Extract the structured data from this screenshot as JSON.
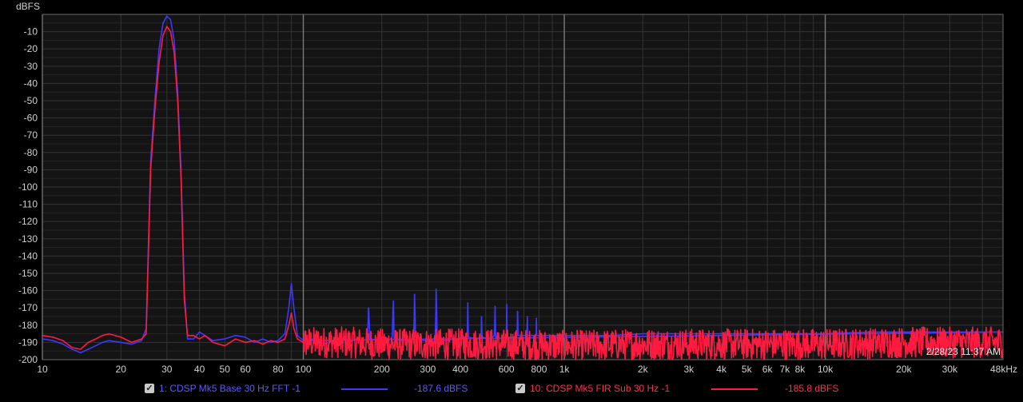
{
  "chart_data": {
    "type": "line",
    "title": "",
    "ylabel": "dBFS",
    "xlabel": "",
    "x_scale": "log",
    "xlim": [
      10,
      48000
    ],
    "ylim": [
      -200,
      0
    ],
    "grid": true,
    "y_ticks": [
      -10,
      -20,
      -30,
      -40,
      -50,
      -60,
      -70,
      -80,
      -90,
      -100,
      -110,
      -120,
      -130,
      -140,
      -150,
      -160,
      -170,
      -180,
      -190,
      -200
    ],
    "x_ticks": [
      {
        "v": 10,
        "label": "10"
      },
      {
        "v": 20,
        "label": "20"
      },
      {
        "v": 30,
        "label": "30"
      },
      {
        "v": 40,
        "label": "40"
      },
      {
        "v": 50,
        "label": "50"
      },
      {
        "v": 60,
        "label": "60"
      },
      {
        "v": 80,
        "label": "80"
      },
      {
        "v": 100,
        "label": "100"
      },
      {
        "v": 200,
        "label": "200"
      },
      {
        "v": 300,
        "label": "300"
      },
      {
        "v": 400,
        "label": "400"
      },
      {
        "v": 600,
        "label": "600"
      },
      {
        "v": 800,
        "label": "800"
      },
      {
        "v": 1000,
        "label": "1k"
      },
      {
        "v": 2000,
        "label": "2k"
      },
      {
        "v": 3000,
        "label": "3k"
      },
      {
        "v": 4000,
        "label": "4k"
      },
      {
        "v": 5000,
        "label": "5k"
      },
      {
        "v": 6000,
        "label": "6k"
      },
      {
        "v": 7000,
        "label": "7k"
      },
      {
        "v": 8000,
        "label": "8k"
      },
      {
        "v": 10000,
        "label": "10k"
      },
      {
        "v": 20000,
        "label": "20k"
      },
      {
        "v": 30000,
        "label": "30k"
      },
      {
        "v": 48000,
        "label": "48kHz"
      }
    ],
    "series": [
      {
        "name": "1: CDSP Mk5 Base 30 Hz FFT -1",
        "color": "#3a3aff",
        "summary_value": "-187.6 dBFS",
        "points": [
          [
            10,
            -188
          ],
          [
            11,
            -189
          ],
          [
            12,
            -191
          ],
          [
            13,
            -194
          ],
          [
            14,
            -196
          ],
          [
            15,
            -194
          ],
          [
            16,
            -192
          ],
          [
            17,
            -190
          ],
          [
            18,
            -189
          ],
          [
            20,
            -190
          ],
          [
            22,
            -191
          ],
          [
            23,
            -190
          ],
          [
            24,
            -189
          ],
          [
            25,
            -182
          ],
          [
            26,
            -85
          ],
          [
            27,
            -50
          ],
          [
            28,
            -20
          ],
          [
            29,
            -5
          ],
          [
            30,
            -1
          ],
          [
            31,
            -3
          ],
          [
            32,
            -15
          ],
          [
            33,
            -45
          ],
          [
            34,
            -90
          ],
          [
            35,
            -160
          ],
          [
            36,
            -188
          ],
          [
            38,
            -188
          ],
          [
            40,
            -184
          ],
          [
            42,
            -186
          ],
          [
            45,
            -189
          ],
          [
            50,
            -188
          ],
          [
            55,
            -186
          ],
          [
            60,
            -187
          ],
          [
            65,
            -190
          ],
          [
            70,
            -188
          ],
          [
            75,
            -190
          ],
          [
            80,
            -189
          ],
          [
            85,
            -185
          ],
          [
            88,
            -170
          ],
          [
            90,
            -156
          ],
          [
            92,
            -170
          ],
          [
            95,
            -186
          ],
          [
            100,
            -189
          ],
          [
            110,
            -188
          ],
          [
            120,
            -191
          ],
          [
            130,
            -189
          ],
          [
            140,
            -188
          ],
          [
            150,
            -190
          ],
          [
            160,
            -188
          ],
          [
            170,
            -189
          ],
          [
            176,
            -188
          ],
          [
            178,
            -171
          ],
          [
            180,
            -188
          ],
          [
            200,
            -189
          ],
          [
            210,
            -190
          ],
          [
            219,
            -187
          ],
          [
            221,
            -170
          ],
          [
            223,
            -188
          ],
          [
            240,
            -189
          ],
          [
            260,
            -188
          ],
          [
            265,
            -187
          ],
          [
            267,
            -164
          ],
          [
            269,
            -187
          ],
          [
            290,
            -189
          ],
          [
            310,
            -189
          ],
          [
            320,
            -187
          ],
          [
            323,
            -165
          ],
          [
            326,
            -187
          ],
          [
            350,
            -189
          ],
          [
            380,
            -188
          ],
          [
            400,
            -188
          ],
          [
            425,
            -186
          ],
          [
            427,
            -172
          ],
          [
            429,
            -187
          ],
          [
            460,
            -188
          ],
          [
            480,
            -187
          ],
          [
            482,
            -175
          ],
          [
            484,
            -187
          ],
          [
            520,
            -188
          ],
          [
            540,
            -186
          ],
          [
            543,
            -172
          ],
          [
            546,
            -187
          ],
          [
            580,
            -188
          ],
          [
            600,
            -186
          ],
          [
            602,
            -168
          ],
          [
            604,
            -187
          ],
          [
            640,
            -187
          ],
          [
            660,
            -186
          ],
          [
            662,
            -172
          ],
          [
            664,
            -186
          ],
          [
            720,
            -186
          ],
          [
            722,
            -175
          ],
          [
            724,
            -186
          ],
          [
            780,
            -186
          ],
          [
            782,
            -176
          ],
          [
            784,
            -186
          ],
          [
            850,
            -186
          ],
          [
            1000,
            -186
          ],
          [
            1200,
            -186
          ],
          [
            1500,
            -186
          ],
          [
            2000,
            -185
          ],
          [
            3000,
            -185
          ],
          [
            4000,
            -185
          ],
          [
            5000,
            -185
          ],
          [
            7000,
            -185
          ],
          [
            10000,
            -185
          ],
          [
            15000,
            -184
          ],
          [
            20000,
            -184
          ],
          [
            30000,
            -184
          ],
          [
            48000,
            -184
          ]
        ]
      },
      {
        "name": "10: CDSP Mk5 FIR Sub 30 Hz -1",
        "color": "#ff1a40",
        "summary_value": "-185.8 dBFS",
        "points": [
          [
            10,
            -186
          ],
          [
            11,
            -187
          ],
          [
            12,
            -189
          ],
          [
            13,
            -193
          ],
          [
            14,
            -194
          ],
          [
            15,
            -190
          ],
          [
            16,
            -188
          ],
          [
            17,
            -186
          ],
          [
            18,
            -185
          ],
          [
            20,
            -187
          ],
          [
            22,
            -190
          ],
          [
            23,
            -189
          ],
          [
            24,
            -188
          ],
          [
            25,
            -185
          ],
          [
            26,
            -90
          ],
          [
            27,
            -55
          ],
          [
            28,
            -28
          ],
          [
            29,
            -12
          ],
          [
            30,
            -7
          ],
          [
            31,
            -10
          ],
          [
            32,
            -22
          ],
          [
            33,
            -50
          ],
          [
            34,
            -95
          ],
          [
            35,
            -165
          ],
          [
            36,
            -186
          ],
          [
            38,
            -186
          ],
          [
            40,
            -188
          ],
          [
            42,
            -186
          ],
          [
            45,
            -190
          ],
          [
            50,
            -192
          ],
          [
            55,
            -188
          ],
          [
            60,
            -190
          ],
          [
            65,
            -189
          ],
          [
            70,
            -191
          ],
          [
            75,
            -189
          ],
          [
            80,
            -190
          ],
          [
            85,
            -188
          ],
          [
            88,
            -180
          ],
          [
            90,
            -173
          ],
          [
            92,
            -182
          ],
          [
            95,
            -188
          ],
          [
            100,
            -190
          ],
          [
            150,
            -190
          ],
          [
            200,
            -191
          ],
          [
            300,
            -191
          ],
          [
            500,
            -191
          ],
          [
            1000,
            -192
          ],
          [
            2000,
            -191
          ],
          [
            5000,
            -191
          ],
          [
            10000,
            -191
          ],
          [
            20000,
            -190
          ],
          [
            48000,
            -190
          ]
        ]
      }
    ]
  },
  "timestamp": "2/28/23 11:37 AM",
  "legend": {
    "items": [
      {
        "label": "1: CDSP Mk5 Base 30 Hz FFT -1",
        "value": "-187.6 dBFS",
        "color": "#3a3aff",
        "checked": true
      },
      {
        "label": "10: CDSP Mk5 FIR Sub 30 Hz -1",
        "value": "-185.8 dBFS",
        "color": "#ff1a40",
        "checked": true
      }
    ]
  }
}
